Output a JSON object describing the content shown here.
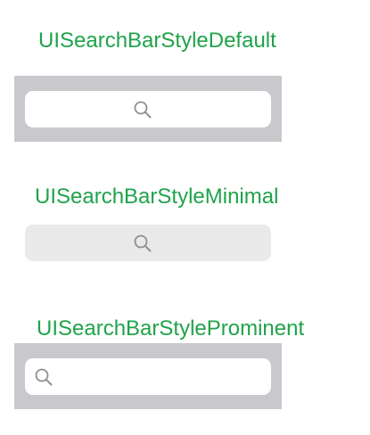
{
  "colors": {
    "label_text": "#1fa34a",
    "bar_background": "#c9c8cd",
    "field_white": "#ffffff",
    "field_minimal": "#e9e9ea",
    "search_icon": "#8e8e93"
  },
  "sections": [
    {
      "title": "UISearchBarStyleDefault",
      "icon": "search-icon",
      "icon_position": "center"
    },
    {
      "title": "UISearchBarStyleMinimal",
      "icon": "search-icon",
      "icon_position": "center"
    },
    {
      "title": "UISearchBarStyleProminent",
      "icon": "search-icon",
      "icon_position": "left"
    }
  ]
}
